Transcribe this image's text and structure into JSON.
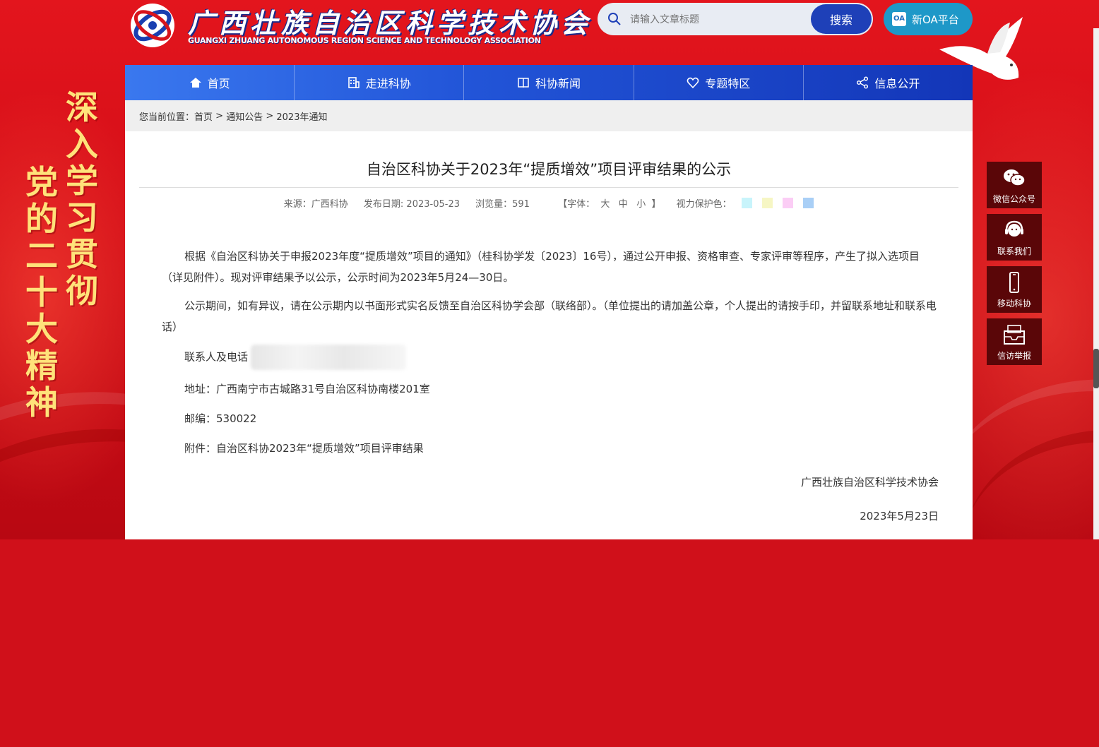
{
  "header": {
    "logo_cn": "广西壮族自治区科学技术协会",
    "logo_en": "GUANGXI ZHUANG AUTONOMOUS REGION SCIENCE AND TECHNOLOGY ASSOCIATION",
    "search_placeholder": "请输入文章标题",
    "search_button": "搜索",
    "oa_button": "新OA平台",
    "oa_icon_text": "OA"
  },
  "nav": [
    {
      "label": "首页",
      "icon": "home-icon"
    },
    {
      "label": "走进科协",
      "icon": "building-icon"
    },
    {
      "label": "科协新闻",
      "icon": "book-icon"
    },
    {
      "label": "专题特区",
      "icon": "heart-icon"
    },
    {
      "label": "信息公开",
      "icon": "share-icon"
    }
  ],
  "breadcrumb": {
    "prefix": "您当前位置：",
    "items": [
      "首页",
      "通知公告",
      "2023年通知"
    ],
    "sep": " > "
  },
  "article": {
    "title": "自治区科协关于2023年“提质增效”项目评审结果的公示",
    "source": "来源：广西科协",
    "date": "发布日期: 2023-05-23",
    "views": "浏览量：591",
    "font_open": "【字体：",
    "font_large": "大",
    "font_medium": "中",
    "font_small": "小",
    "font_close": "】",
    "eye_care": "视力保护色：",
    "eye_colors": [
      "#c8f4fb",
      "#f6f6c4",
      "#fbcdf5",
      "#a9cff6"
    ],
    "para1": "根据《自治区科协关于申报2023年度“提质增效”项目的通知》（桂科协学发〔2023〕16号），通过公开申报、资格审查、专家评审等程序，产生了拟入选项目（详见附件）。现对评审结果予以公示，公示时间为2023年5月24—30日。",
    "para2": "公示期间，如有异议，请在公示期内以书面形式实名反馈至自治区科协学会部（联络部）。（单位提出的请加盖公章，个人提出的请按手印，并留联系地址和联系电话）",
    "contact": "联系人及电话",
    "address": "地址：广西南宁市古城路31号自治区科协南楼201室",
    "postcode": "邮编：530022",
    "attachment": "附件：自治区科协2023年“提质增效”项目评审结果",
    "signature": "广西壮族自治区科学技术协会",
    "sign_date": "2023年5月23日"
  },
  "slogan": {
    "col1": "深入学习贯彻",
    "col2": "党的二十大精神"
  },
  "float_bar": [
    {
      "label": "微信公众号",
      "icon": "wechat-icon"
    },
    {
      "label": "联系我们",
      "icon": "headset-icon"
    },
    {
      "label": "移动科协",
      "icon": "phone-icon"
    },
    {
      "label": "信访举报",
      "icon": "inbox-icon"
    }
  ]
}
